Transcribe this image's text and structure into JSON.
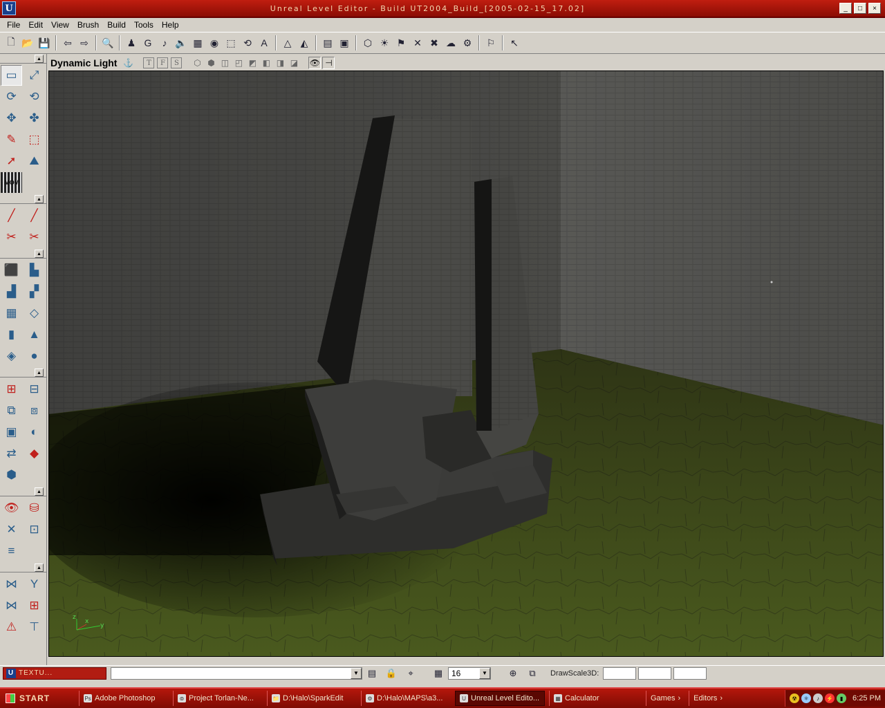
{
  "window": {
    "logo": "U",
    "title": "Unreal Level Editor - Build UT2004_Build_[2005-02-15_17.02]",
    "minimize": "_",
    "maximize": "□",
    "close": "×"
  },
  "menu": [
    "File",
    "Edit",
    "View",
    "Brush",
    "Build",
    "Tools",
    "Help"
  ],
  "toolbar": {
    "icons": [
      "new-icon",
      "open-icon",
      "save-icon",
      "sep",
      "undo-icon",
      "redo-icon",
      "sep",
      "find-icon",
      "sep",
      "actor-icon",
      "group-icon",
      "music-icon",
      "sound-icon",
      "texture-icon",
      "mesh-icon",
      "static-mesh-icon",
      "animation-icon",
      "font-icon",
      "sep",
      "prefab-icon",
      "terrain-icon",
      "sep",
      "properties-icon",
      "surface-icon",
      "sep",
      "build-geometry-icon",
      "build-lighting-icon",
      "build-paths-icon",
      "build-cover-icon",
      "build-all-icon",
      "build-options-icon",
      "settings-icon",
      "sep",
      "play-icon",
      "sep",
      "help-icon"
    ],
    "glyphs": {
      "new-icon": "🗋",
      "open-icon": "📂",
      "save-icon": "💾",
      "undo-icon": "⇦",
      "redo-icon": "⇨",
      "find-icon": "🔍",
      "actor-icon": "♟",
      "group-icon": "G",
      "music-icon": "♪",
      "sound-icon": "🔈",
      "texture-icon": "▦",
      "mesh-icon": "◉",
      "static-mesh-icon": "⬚",
      "animation-icon": "⟲",
      "font-icon": "A",
      "prefab-icon": "△",
      "terrain-icon": "◭",
      "properties-icon": "▤",
      "surface-icon": "▣",
      "build-geometry-icon": "⬡",
      "build-lighting-icon": "☀",
      "build-paths-icon": "⚑",
      "build-cover-icon": "✕",
      "build-all-icon": "✖",
      "build-options-icon": "☁",
      "settings-icon": "⚙",
      "play-icon": "⚐",
      "help-icon": "↖"
    }
  },
  "tool_groups": [
    {
      "tools": [
        [
          "camera-mode-icon",
          "▭",
          false,
          true
        ],
        [
          "scale-mode-icon",
          "⤢",
          false,
          false
        ],
        [
          "rotate-mode-icon",
          "⟳",
          false,
          false
        ],
        [
          "texture-pan-icon",
          "⟲",
          false,
          false
        ],
        [
          "move-mode-icon",
          "✥",
          false,
          false
        ],
        [
          "terrain-mode-icon",
          "✤",
          false,
          false
        ],
        [
          "vertex-edit-icon",
          "✎",
          true,
          false
        ],
        [
          "brush-clip-icon",
          "⬚",
          true,
          false
        ],
        [
          "polygon-icon",
          "➚",
          true,
          false
        ],
        [
          "face-drag-icon",
          "⛰",
          false,
          false
        ],
        [
          "matinee-icon",
          "MOV",
          false,
          false
        ]
      ]
    },
    {
      "tools": [
        [
          "brush-line-icon",
          "╱",
          true,
          false
        ],
        [
          "brush-line-alt-icon",
          "╱",
          true,
          false
        ],
        [
          "split-icon",
          "✂",
          true,
          false
        ],
        [
          "split-alt-icon",
          "✂",
          true,
          false
        ]
      ]
    },
    {
      "tools": [
        [
          "cube-icon",
          "⬛",
          false,
          false
        ],
        [
          "stairs-icon",
          "▙",
          false,
          false
        ],
        [
          "curved-stairs-icon",
          "▟",
          false,
          false
        ],
        [
          "spiral-stairs-icon",
          "▞",
          false,
          false
        ],
        [
          "sheet-icon",
          "▦",
          false,
          false
        ],
        [
          "plane-icon",
          "◇",
          false,
          false
        ],
        [
          "cylinder-icon",
          "▮",
          false,
          false
        ],
        [
          "cone-icon",
          "▲",
          false,
          false
        ],
        [
          "tetra-icon",
          "◈",
          false,
          false
        ],
        [
          "sphere-icon",
          "●",
          false,
          false
        ]
      ]
    },
    {
      "tools": [
        [
          "csg-add-icon",
          "⊞",
          true,
          false
        ],
        [
          "csg-subtract-icon",
          "⊟",
          false,
          false
        ],
        [
          "csg-intersect-icon",
          "⧉",
          false,
          false
        ],
        [
          "csg-deintersect-icon",
          "⧈",
          false,
          false
        ],
        [
          "add-special-icon",
          "▣",
          false,
          false
        ],
        [
          "add-mover-icon",
          "◐",
          false,
          false
        ],
        [
          "add-volume-icon",
          "⇄",
          false,
          false
        ],
        [
          "add-antiportal-icon",
          "◆",
          true,
          false
        ],
        [
          "static-mesh-add-icon",
          "⬢",
          false,
          false
        ]
      ]
    },
    {
      "tools": [
        [
          "show-selected-icon",
          "👁",
          true,
          false
        ],
        [
          "hide-selected-icon",
          "⛁",
          true,
          false
        ],
        [
          "select-invert-icon",
          "✕",
          false,
          false
        ],
        [
          "show-all-icon",
          "⊡",
          false,
          false
        ],
        [
          "clip-icon",
          "≡",
          false,
          false
        ]
      ]
    },
    {
      "tools": [
        [
          "mirror-x-icon",
          "⋈",
          false,
          false
        ],
        [
          "mirror-y-icon",
          "Y",
          false,
          false
        ],
        [
          "mirror-z-icon",
          "⋈",
          false,
          false
        ],
        [
          "snap-grid-icon",
          "⊞",
          true,
          false
        ],
        [
          "lock-icon",
          "⚠",
          true,
          false
        ],
        [
          "align-icon",
          "⊤",
          false,
          false
        ]
      ]
    }
  ],
  "viewport": {
    "title": "Dynamic Light",
    "view_buttons": [
      "T",
      "F",
      "S"
    ],
    "render_icons": [
      "wireframe-icon",
      "zone-icon",
      "texture-usage-icon",
      "bsp-icon",
      "dynamic-light-icon",
      "lighting-only-icon",
      "depth-icon",
      "unlit-icon"
    ],
    "axis": {
      "x": "x",
      "y": "y",
      "z": "z"
    }
  },
  "bottom": {
    "texture_tab": "TEXTU...",
    "command_value": "",
    "grid_value": "16",
    "drawscale_label": "DrawScale3D:"
  },
  "taskbar": {
    "start": "START",
    "tasks": [
      {
        "label": "Adobe Photoshop",
        "icon": "Ps",
        "active": false,
        "width": 130
      },
      {
        "label": "Project Torlan-Ne...",
        "icon": "⊚",
        "active": false,
        "width": 130
      },
      {
        "label": "D:\\Halo\\SparkEdit",
        "icon": "📁",
        "active": false,
        "width": 130
      },
      {
        "label": "D:\\Halo\\MAPS\\a3...",
        "icon": "⚙",
        "active": false,
        "width": 130
      },
      {
        "label": "Unreal Level Edito...",
        "icon": "U",
        "active": true,
        "width": 130
      },
      {
        "label": "Calculator",
        "icon": "▦",
        "active": false,
        "width": 134
      }
    ],
    "quick": [
      {
        "label": "Games"
      },
      {
        "label": "Editors"
      }
    ],
    "clock": "6:25 PM"
  }
}
